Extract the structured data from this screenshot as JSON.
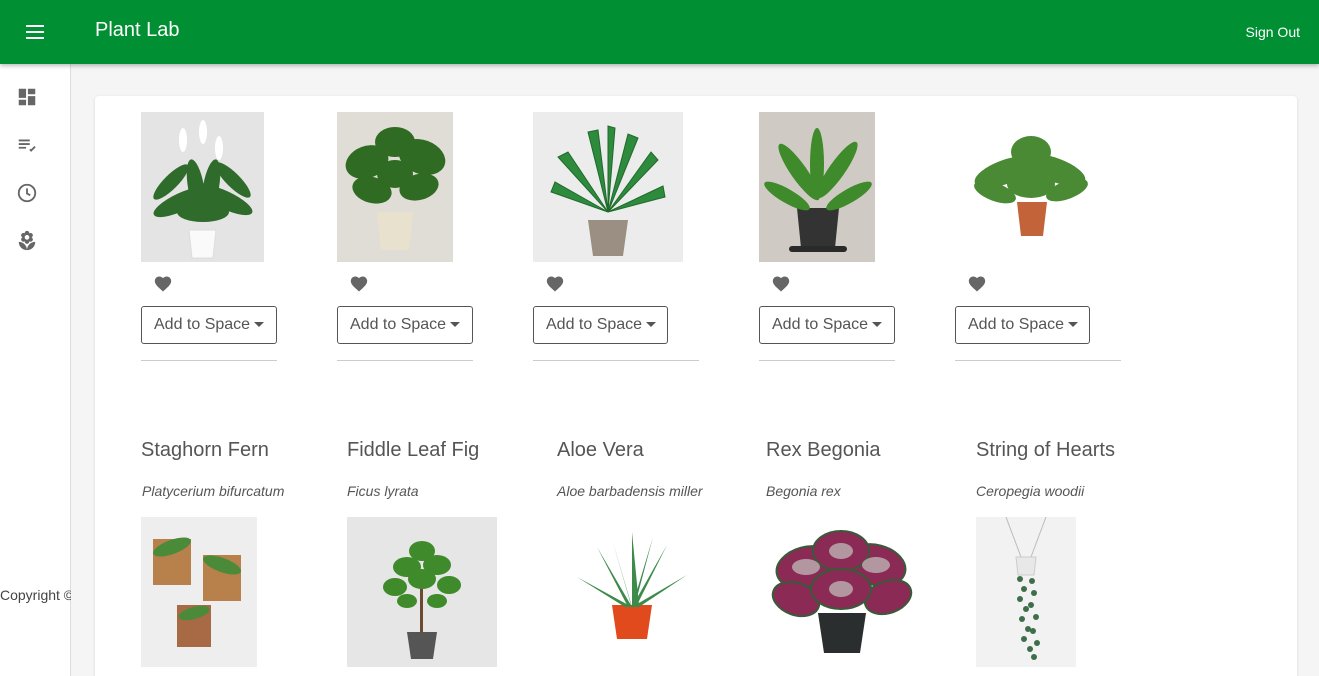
{
  "app": {
    "title": "Plant Lab",
    "sign_out_label": "Sign Out"
  },
  "sidebar": {
    "items": [
      {
        "icon": "dashboard-icon"
      },
      {
        "icon": "playlist-check-icon"
      },
      {
        "icon": "clock-icon"
      },
      {
        "icon": "plant-icon"
      }
    ],
    "copyright": "Copyright ©"
  },
  "top_row": {
    "add_to_space_label": "Add to Space",
    "plants": [
      {
        "image": "peace-lily-image"
      },
      {
        "image": "monstera-image"
      },
      {
        "image": "philodendron-image"
      },
      {
        "image": "birds-nest-fern-image"
      },
      {
        "image": "rabbit-foot-fern-image"
      }
    ]
  },
  "bottom_row": {
    "plants": [
      {
        "name": "Staghorn Fern",
        "scientific": "Platycerium bifurcatum",
        "image": "staghorn-fern-image"
      },
      {
        "name": "Fiddle Leaf Fig",
        "scientific": "Ficus lyrata",
        "image": "fiddle-leaf-fig-image"
      },
      {
        "name": "Aloe Vera",
        "scientific": "Aloe barbadensis miller",
        "image": "aloe-vera-image"
      },
      {
        "name": "Rex Begonia",
        "scientific": "Begonia rex",
        "image": "rex-begonia-image"
      },
      {
        "name": "String of Hearts",
        "scientific": "Ceropegia woodii",
        "image": "string-of-hearts-image"
      }
    ]
  },
  "colors": {
    "appbar": "#008f33",
    "text": "#555555"
  }
}
